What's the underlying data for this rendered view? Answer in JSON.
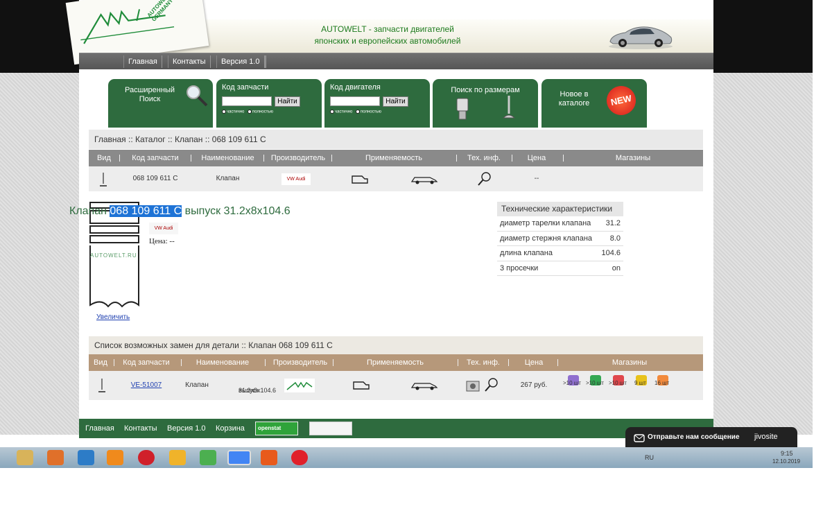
{
  "header": {
    "logo_text": "AUTOWELT GERMANY",
    "tagline_1": "AUTOWELT - запчасти двигателей",
    "tagline_2": "японских и европейских автомобилей"
  },
  "nav": {
    "items": [
      "Главная",
      "Контакты",
      "Версия 1.0"
    ]
  },
  "search": {
    "advanced_label": "Расширенный Поиск",
    "part_code_title": "Код запчасти",
    "engine_code_title": "Код двигателя",
    "find_button": "Найти",
    "radio_partial": "частично",
    "radio_full": "полностью",
    "size_search_title": "Поиск по размерам",
    "new_in_catalog": "Новое в каталоге",
    "new_badge": "NEW"
  },
  "breadcrumb": "Главная :: Каталог :: Клапан :: 068 109 611 С",
  "table": {
    "headers": [
      "Вид",
      "Код запчасти",
      "Наименование",
      "Производитель",
      "Применяемость",
      "Тех. инф.",
      "Цена",
      "Магазины"
    ],
    "row": {
      "code": "068 109 611 С",
      "name": "Клапан",
      "maker": "VW Audi",
      "price": "--"
    }
  },
  "detail": {
    "title_prefix": "Клапан ",
    "title_code": "068 109 611 С",
    "title_suffix": " выпуск 31.2x8x104.6",
    "price_label": "Цена: --",
    "enlarge_link": "Увеличить",
    "watermark": "AUTOWELT.RU"
  },
  "specs": {
    "title": "Технические характеристики",
    "rows": [
      {
        "k": "диаметр тарелки клапана",
        "v": "31.2"
      },
      {
        "k": "диаметр стержня клапана",
        "v": "8.0"
      },
      {
        "k": "длина клапана",
        "v": "104.6"
      },
      {
        "k": "3 просечки",
        "v": "on"
      }
    ]
  },
  "replacements": {
    "title": "Список возможных замен для детали :: Клапан 068 109 611 С",
    "headers": [
      "Вид",
      "Код запчасти",
      "Наименование",
      "Производитель",
      "Применяемость",
      "Тех. инф.",
      "Цена",
      "Магазины"
    ],
    "row": {
      "code": "VE-51007",
      "name": "Клапан",
      "desc_1": "выпуск",
      "desc_2": "31.2x8x104.6",
      "price": "267 руб.",
      "stores": [
        {
          "color": "#8f6fcf",
          "qty": ">10 шт"
        },
        {
          "color": "#34a853",
          "qty": ">10 шт"
        },
        {
          "color": "#e0474c",
          "qty": ">10 шт"
        },
        {
          "color": "#e8c21b",
          "qty": "9 шт"
        },
        {
          "color": "#f28a3c",
          "qty": "16 шт"
        }
      ]
    }
  },
  "footer": {
    "items": [
      "Главная",
      "Контакты",
      "Версия 1.0",
      "Корзина"
    ],
    "openstat": "openstat"
  },
  "chat": {
    "message": "Отправьте нам сообщение",
    "brand": "jivosite"
  },
  "taskbar": {
    "lang": "RU",
    "time": "9:15",
    "date": "12.10.2019"
  },
  "colors": {
    "brand_green": "#2e6b3e",
    "table_header": "#8a8a8a",
    "replacement_header": "#b6987a",
    "selection": "#1e73d6"
  }
}
